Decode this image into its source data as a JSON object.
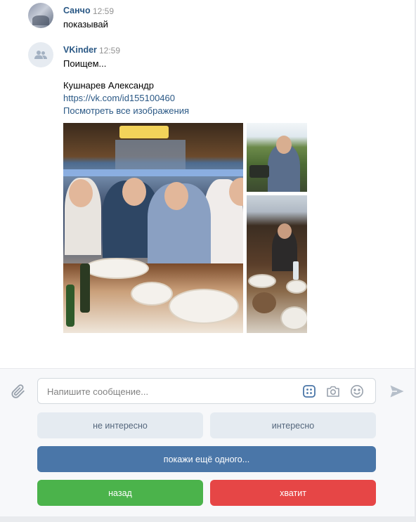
{
  "messages": [
    {
      "author": "Санчо",
      "time": "12:59",
      "text": "показывай"
    },
    {
      "author": "VKinder",
      "time": "12:59",
      "text": "Поищем...",
      "profile_name": "Кушнарев Александр",
      "profile_link": "https://vk.com/id155100460",
      "all_images_link": "Посмотреть все изображения"
    }
  ],
  "composer": {
    "placeholder": "Напишите сообщение...",
    "attach_icon": "paperclip-icon",
    "keyboard_icon": "keyboard-icon",
    "camera_icon": "camera-icon",
    "emoji_icon": "emoji-icon",
    "send_icon": "send-icon"
  },
  "keyboard": {
    "not_interested": "не интересно",
    "interested": "интересно",
    "show_another": "покажи ещё одного...",
    "back": "назад",
    "stop": "хватит"
  },
  "colors": {
    "link": "#2a5885",
    "primary": "#4a76a8",
    "secondary": "#e5ebf1",
    "positive": "#4bb34b",
    "negative": "#e64646"
  }
}
